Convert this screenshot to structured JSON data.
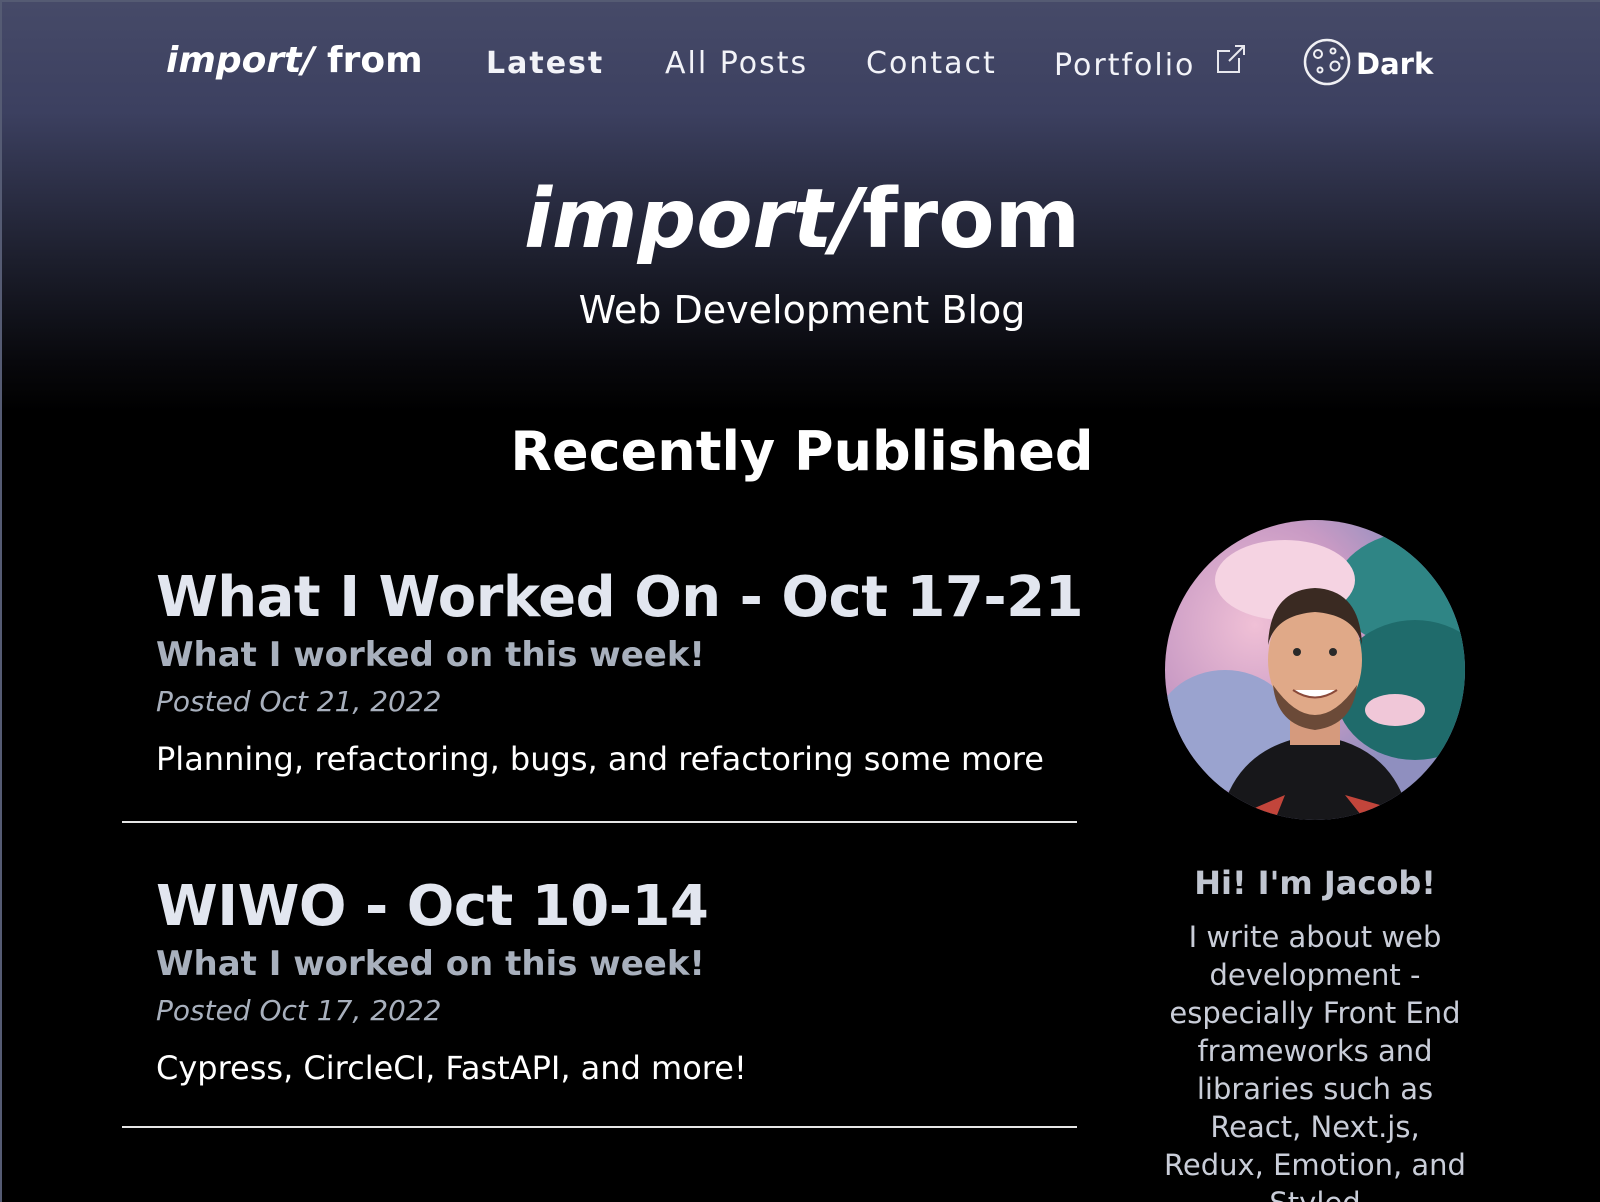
{
  "nav": {
    "logo_italic": "import/",
    "logo_rest": " from",
    "links": [
      {
        "label": "Latest"
      },
      {
        "label": "All Posts"
      },
      {
        "label": "Contact"
      },
      {
        "label": "Portfolio"
      }
    ],
    "portfolio_icon": "external-link-icon",
    "theme_icon": "moon-icon",
    "theme_label": "Dark"
  },
  "hero": {
    "title_italic": "import/",
    "title_rest": "from",
    "subtitle": "Web Development Blog"
  },
  "section_title": "Recently Published",
  "posts": [
    {
      "title": "What I Worked On - Oct 17-21",
      "subtitle": "What I worked on this week!",
      "date": "Posted Oct 21, 2022",
      "excerpt": "Planning, refactoring, bugs, and refactoring some more"
    },
    {
      "title": "WIWO - Oct 10-14",
      "subtitle": "What I worked on this week!",
      "date": "Posted Oct 17, 2022",
      "excerpt": "Cypress, CircleCI, FastAPI, and more!"
    }
  ],
  "sidebar": {
    "greeting": "Hi! I'm Jacob!",
    "bio": "I write about web development - especially Front End frameworks and libraries such as React, Next.js, Redux, Emotion, and Styled"
  },
  "colors": {
    "background": "#000000",
    "header_gradient_top": "#464a68",
    "post_title": "#e2e6ef",
    "post_meta": "#a8b0bd"
  }
}
